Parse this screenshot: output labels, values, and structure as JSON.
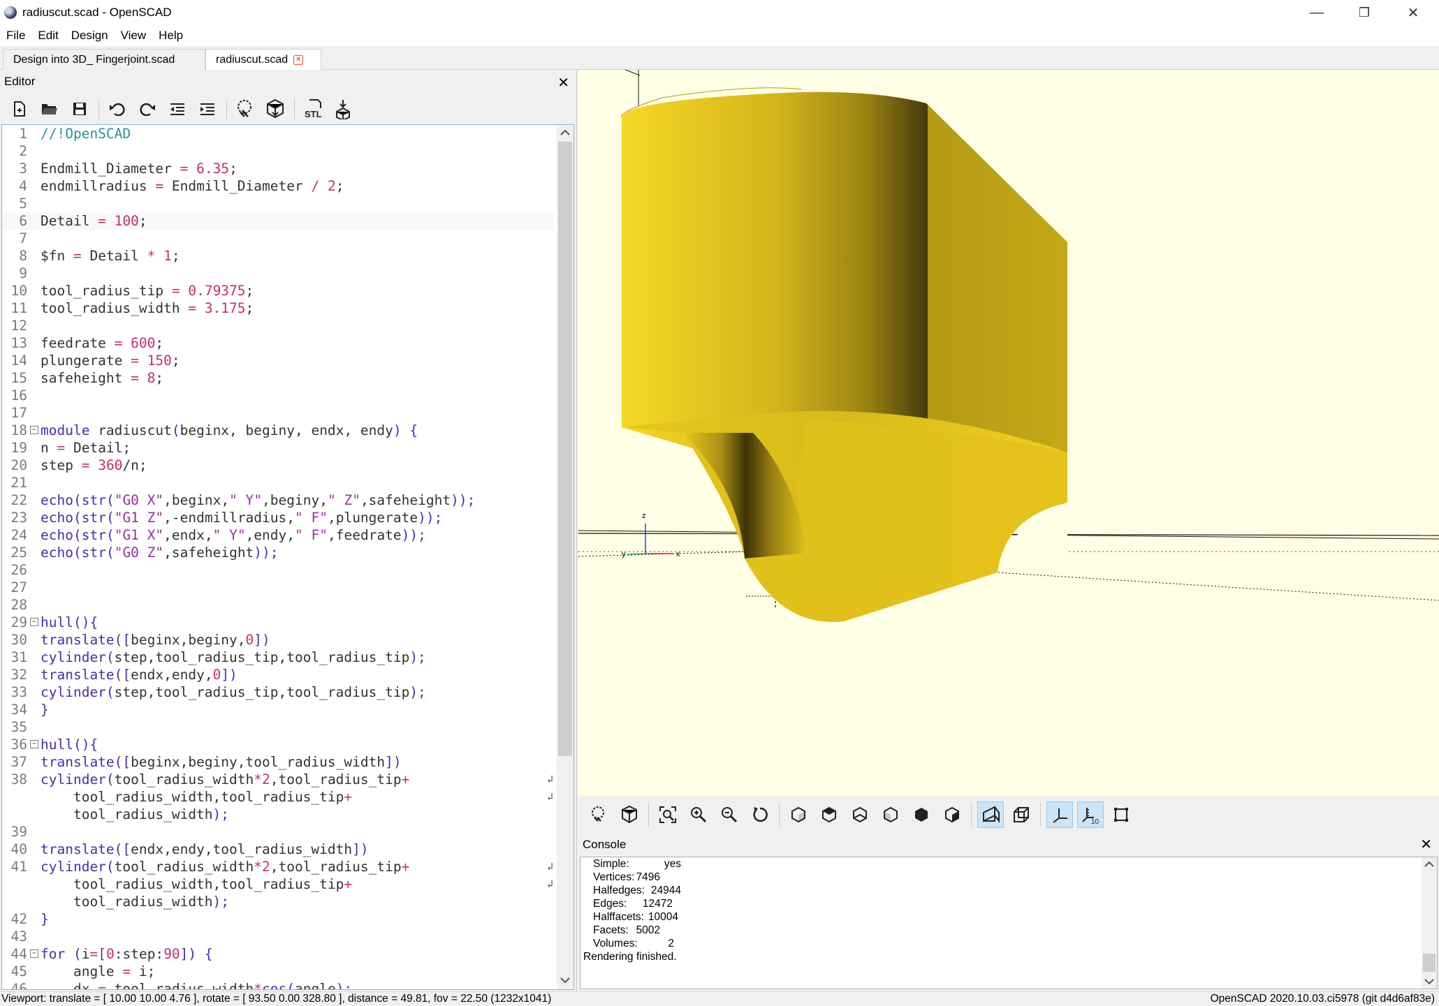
{
  "window": {
    "title": "radiuscut.scad - OpenSCAD",
    "minimize": "—",
    "maximize": "❐",
    "close": "✕"
  },
  "menu": [
    "File",
    "Edit",
    "Design",
    "View",
    "Help"
  ],
  "tabs": [
    {
      "label": "Design into 3D_ Fingerjoint.scad"
    },
    {
      "label": "radiuscut.scad",
      "close": "×"
    }
  ],
  "editor": {
    "title": "Editor",
    "close": "✕",
    "toolbar": [
      "new-file-icon",
      "open-file-icon",
      "save-icon",
      "undo-icon",
      "redo-icon",
      "unindent-icon",
      "indent-icon",
      "preview-icon",
      "render-icon",
      "export-stl-icon",
      "send-to-print-icon"
    ],
    "stl_label": "STL",
    "lines": [
      {
        "n": "1",
        "t": [
          [
            "//!OpenSCAD",
            "comment"
          ]
        ]
      },
      {
        "n": "2",
        "t": []
      },
      {
        "n": "3",
        "t": [
          [
            "Endmill_Diameter ",
            ""
          ],
          [
            "=",
            "op"
          ],
          [
            " ",
            ""
          ],
          [
            "6.35",
            "num"
          ],
          [
            ";",
            ""
          ]
        ]
      },
      {
        "n": "4",
        "t": [
          [
            "endmillradius ",
            ""
          ],
          [
            "=",
            "op"
          ],
          [
            " Endmill_Diameter ",
            ""
          ],
          [
            "/",
            "op"
          ],
          [
            " ",
            ""
          ],
          [
            "2",
            "num"
          ],
          [
            ";",
            ""
          ]
        ]
      },
      {
        "n": "5",
        "t": []
      },
      {
        "n": "6",
        "t": [
          [
            "Detail ",
            ""
          ],
          [
            "=",
            "op"
          ],
          [
            " ",
            ""
          ],
          [
            "100",
            "num"
          ],
          [
            ";",
            ""
          ]
        ],
        "current": true
      },
      {
        "n": "7",
        "t": []
      },
      {
        "n": "8",
        "t": [
          [
            "$fn ",
            ""
          ],
          [
            "=",
            "op"
          ],
          [
            " Detail ",
            ""
          ],
          [
            "*",
            "op"
          ],
          [
            " ",
            ""
          ],
          [
            "1",
            "num"
          ],
          [
            ";",
            ""
          ]
        ]
      },
      {
        "n": "9",
        "t": []
      },
      {
        "n": "10",
        "t": [
          [
            "tool_radius_tip ",
            ""
          ],
          [
            "=",
            "op"
          ],
          [
            " ",
            ""
          ],
          [
            "0.79375",
            "num"
          ],
          [
            ";",
            ""
          ]
        ]
      },
      {
        "n": "11",
        "t": [
          [
            "tool_radius_width ",
            ""
          ],
          [
            "=",
            "op"
          ],
          [
            " ",
            ""
          ],
          [
            "3.175",
            "num"
          ],
          [
            ";",
            ""
          ]
        ]
      },
      {
        "n": "12",
        "t": []
      },
      {
        "n": "13",
        "t": [
          [
            "feedrate ",
            ""
          ],
          [
            "=",
            "op"
          ],
          [
            " ",
            ""
          ],
          [
            "600",
            "num"
          ],
          [
            ";",
            ""
          ]
        ]
      },
      {
        "n": "14",
        "t": [
          [
            "plungerate ",
            ""
          ],
          [
            "=",
            "op"
          ],
          [
            " ",
            ""
          ],
          [
            "150",
            "num"
          ],
          [
            ";",
            ""
          ]
        ]
      },
      {
        "n": "15",
        "t": [
          [
            "safeheight ",
            ""
          ],
          [
            "=",
            "op"
          ],
          [
            " ",
            ""
          ],
          [
            "8",
            "num"
          ],
          [
            ";",
            ""
          ]
        ]
      },
      {
        "n": "16",
        "t": []
      },
      {
        "n": "17",
        "t": []
      },
      {
        "n": "18",
        "t": [
          [
            "module",
            "kw"
          ],
          [
            " radiuscut",
            ""
          ],
          [
            "(",
            "kw"
          ],
          [
            "beginx, beginy, endx, endy",
            ""
          ],
          [
            ")",
            "kw"
          ],
          [
            " ",
            ""
          ],
          [
            "{",
            "kw"
          ]
        ],
        "fold": "−"
      },
      {
        "n": "19",
        "t": [
          [
            "n ",
            ""
          ],
          [
            "=",
            "op"
          ],
          [
            " Detail;",
            ""
          ]
        ]
      },
      {
        "n": "20",
        "t": [
          [
            "step ",
            ""
          ],
          [
            "=",
            "op"
          ],
          [
            " ",
            ""
          ],
          [
            "360",
            "num"
          ],
          [
            "/n;",
            ""
          ]
        ]
      },
      {
        "n": "21",
        "t": []
      },
      {
        "n": "22",
        "t": [
          [
            "echo",
            "kw"
          ],
          [
            "(",
            "kw"
          ],
          [
            "str",
            "kw"
          ],
          [
            "(",
            "kw"
          ],
          [
            "\"G0 X\"",
            "str"
          ],
          [
            ",beginx,",
            ""
          ],
          [
            "\" Y\"",
            "str"
          ],
          [
            ",beginy,",
            ""
          ],
          [
            "\" Z\"",
            "str"
          ],
          [
            ",safeheight",
            ""
          ],
          [
            "));",
            "kw"
          ]
        ]
      },
      {
        "n": "23",
        "t": [
          [
            "echo",
            "kw"
          ],
          [
            "(",
            "kw"
          ],
          [
            "str",
            "kw"
          ],
          [
            "(",
            "kw"
          ],
          [
            "\"G1 Z\"",
            "str"
          ],
          [
            ",-endmillradius,",
            ""
          ],
          [
            "\" F\"",
            "str"
          ],
          [
            ",plungerate",
            ""
          ],
          [
            "));",
            "kw"
          ]
        ]
      },
      {
        "n": "24",
        "t": [
          [
            "echo",
            "kw"
          ],
          [
            "(",
            "kw"
          ],
          [
            "str",
            "kw"
          ],
          [
            "(",
            "kw"
          ],
          [
            "\"G1 X\"",
            "str"
          ],
          [
            ",endx,",
            ""
          ],
          [
            "\" Y\"",
            "str"
          ],
          [
            ",endy,",
            ""
          ],
          [
            "\" F\"",
            "str"
          ],
          [
            ",feedrate",
            ""
          ],
          [
            "));",
            "kw"
          ]
        ]
      },
      {
        "n": "25",
        "t": [
          [
            "echo",
            "kw"
          ],
          [
            "(",
            "kw"
          ],
          [
            "str",
            "kw"
          ],
          [
            "(",
            "kw"
          ],
          [
            "\"G0 Z\"",
            "str"
          ],
          [
            ",safeheight",
            ""
          ],
          [
            "));",
            "kw"
          ]
        ]
      },
      {
        "n": "26",
        "t": []
      },
      {
        "n": "27",
        "t": []
      },
      {
        "n": "28",
        "t": []
      },
      {
        "n": "29",
        "t": [
          [
            "hull",
            "kw"
          ],
          [
            "(){",
            "kw"
          ]
        ],
        "fold": "−"
      },
      {
        "n": "30",
        "t": [
          [
            "translate",
            "kw"
          ],
          [
            "([",
            "kw"
          ],
          [
            "beginx,beginy,",
            ""
          ],
          [
            "0",
            "num"
          ],
          [
            "])",
            "kw"
          ]
        ]
      },
      {
        "n": "31",
        "t": [
          [
            "cylinder",
            "kw"
          ],
          [
            "(",
            "kw"
          ],
          [
            "step,tool_radius_tip,tool_radius_tip",
            ""
          ],
          [
            ");",
            "kw"
          ]
        ]
      },
      {
        "n": "32",
        "t": [
          [
            "translate",
            "kw"
          ],
          [
            "([",
            "kw"
          ],
          [
            "endx,endy,",
            ""
          ],
          [
            "0",
            "num"
          ],
          [
            "])",
            "kw"
          ]
        ]
      },
      {
        "n": "33",
        "t": [
          [
            "cylinder",
            "kw"
          ],
          [
            "(",
            "kw"
          ],
          [
            "step,tool_radius_tip,tool_radius_tip",
            ""
          ],
          [
            ");",
            "kw"
          ]
        ]
      },
      {
        "n": "34",
        "t": [
          [
            "}",
            "kw"
          ]
        ]
      },
      {
        "n": "35",
        "t": []
      },
      {
        "n": "36",
        "t": [
          [
            "hull",
            "kw"
          ],
          [
            "(){",
            "kw"
          ]
        ],
        "fold": "−"
      },
      {
        "n": "37",
        "t": [
          [
            "translate",
            "kw"
          ],
          [
            "([",
            "kw"
          ],
          [
            "beginx,beginy,tool_radius_width",
            ""
          ],
          [
            "])",
            "kw"
          ]
        ]
      },
      {
        "n": "38",
        "t": [
          [
            "cylinder",
            "kw"
          ],
          [
            "(",
            "kw"
          ],
          [
            "tool_radius_width",
            ""
          ],
          [
            "*",
            "op"
          ],
          [
            "2",
            "num"
          ],
          [
            ",tool_radius_tip",
            ""
          ],
          [
            "+",
            "op"
          ]
        ],
        "wrap": true
      },
      {
        "n": "",
        "t": [
          [
            "    tool_radius_width,tool_radius_tip",
            ""
          ],
          [
            "+",
            "op"
          ]
        ],
        "wrap": true
      },
      {
        "n": "",
        "t": [
          [
            "    tool_radius_width",
            ""
          ],
          [
            ");",
            "kw"
          ]
        ]
      },
      {
        "n": "39",
        "t": []
      },
      {
        "n": "40",
        "t": [
          [
            "translate",
            "kw"
          ],
          [
            "([",
            "kw"
          ],
          [
            "endx,endy,tool_radius_width",
            ""
          ],
          [
            "])",
            "kw"
          ]
        ]
      },
      {
        "n": "41",
        "t": [
          [
            "cylinder",
            "kw"
          ],
          [
            "(",
            "kw"
          ],
          [
            "tool_radius_width",
            ""
          ],
          [
            "*",
            "op"
          ],
          [
            "2",
            "num"
          ],
          [
            ",tool_radius_tip",
            ""
          ],
          [
            "+",
            "op"
          ]
        ],
        "wrap": true
      },
      {
        "n": "",
        "t": [
          [
            "    tool_radius_width,tool_radius_tip",
            ""
          ],
          [
            "+",
            "op"
          ]
        ],
        "wrap": true
      },
      {
        "n": "",
        "t": [
          [
            "    tool_radius_width",
            ""
          ],
          [
            ");",
            "kw"
          ]
        ]
      },
      {
        "n": "42",
        "t": [
          [
            "}",
            "kw"
          ]
        ]
      },
      {
        "n": "43",
        "t": []
      },
      {
        "n": "44",
        "t": [
          [
            "for",
            "kw"
          ],
          [
            " ",
            ""
          ],
          [
            "(",
            "kw"
          ],
          [
            "i",
            ""
          ],
          [
            "=",
            "op"
          ],
          [
            "[",
            "kw"
          ],
          [
            "0",
            "num"
          ],
          [
            ":step:",
            ""
          ],
          [
            "90",
            "num"
          ],
          [
            "])",
            "kw"
          ],
          [
            " ",
            ""
          ],
          [
            "{",
            "kw"
          ]
        ],
        "fold": "−"
      },
      {
        "n": "45",
        "t": [
          [
            "    angle ",
            ""
          ],
          [
            "=",
            "op"
          ],
          [
            " i;",
            ""
          ]
        ]
      },
      {
        "n": "46",
        "t": [
          [
            "    dx ",
            ""
          ],
          [
            "=",
            "op"
          ],
          [
            " tool_radius_width",
            ""
          ],
          [
            "*",
            "op"
          ],
          [
            "cos",
            "kw"
          ],
          [
            "(",
            "kw"
          ],
          [
            "angle",
            ""
          ],
          [
            ");",
            "kw"
          ]
        ]
      }
    ],
    "wrap_glyph": "↲"
  },
  "view_toolbar": {
    "icons": [
      "preview-icon",
      "render-icon",
      "view-all-icon",
      "zoom-in-icon",
      "zoom-out-icon",
      "reset-view-icon",
      "view-right-icon",
      "view-top-icon",
      "view-bottom-icon",
      "view-left-icon",
      "view-front-icon",
      "view-back-icon",
      "perspective-icon",
      "orthogonal-icon",
      "show-axes-icon",
      "show-scale-markers-icon",
      "show-edges-icon"
    ],
    "scale_label": "10"
  },
  "viewport": {
    "axis_x": "x",
    "axis_y": "y",
    "axis_z": "z",
    "model_color": "#f2d21c",
    "bg_color": "#ffffe5"
  },
  "console": {
    "title": "Console",
    "close": "✕",
    "stats": [
      {
        "label": "Simple:",
        "value": "yes"
      },
      {
        "label": "Vertices:",
        "value": "7496"
      },
      {
        "label": "Halfedges:",
        "value": "24944"
      },
      {
        "label": "Edges:",
        "value": "12472"
      },
      {
        "label": "Halffacets:",
        "value": "10004"
      },
      {
        "label": "Facets:",
        "value": "5002"
      },
      {
        "label": "Volumes:",
        "value": "2"
      }
    ],
    "final": "Rendering finished."
  },
  "status": {
    "viewport": "Viewport: translate = [ 10.00 10.00 4.76 ], rotate = [ 93.50 0.00 328.80 ], distance = 49.81, fov = 22.50 (1232x1041)",
    "version": "OpenSCAD 2020.10.03.ci5978 (git d4d6af83e)"
  }
}
